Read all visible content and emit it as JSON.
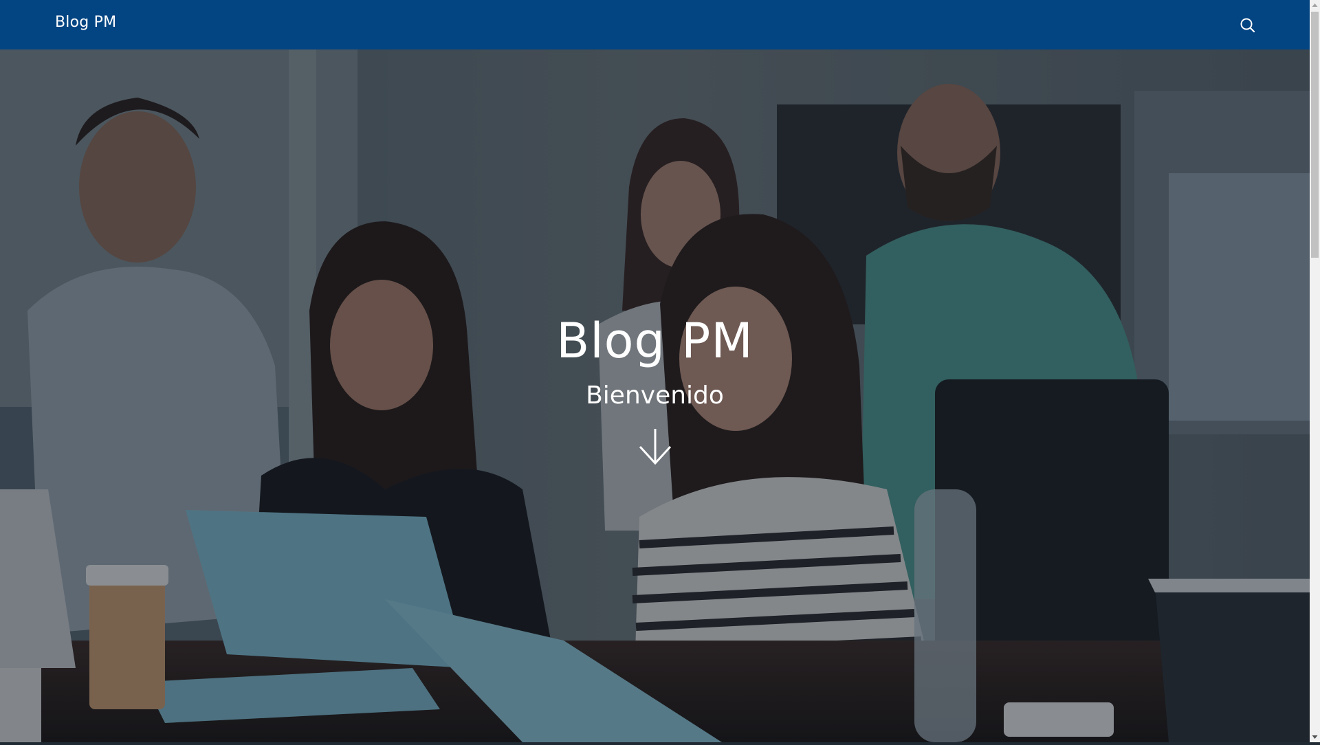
{
  "navbar": {
    "brand": "Blog PM",
    "search_icon": "search-icon",
    "background_color": "#034482"
  },
  "hero": {
    "title": "Blog PM",
    "subtitle": "Bienvenido",
    "scroll_icon": "arrow-down-icon",
    "image_description_icon": "team-meeting-photo"
  },
  "scrollbar": {
    "up_icon": "triangle-up-icon",
    "down_icon": "triangle-down-icon"
  }
}
